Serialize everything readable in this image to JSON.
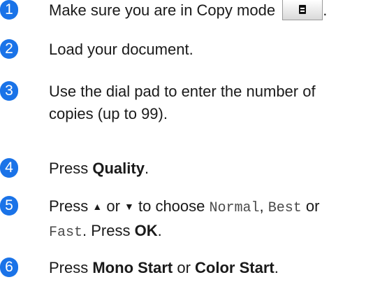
{
  "steps": [
    {
      "num": "1",
      "text": "Make sure you are in Copy mode",
      "after": "."
    },
    {
      "num": "2",
      "text": "Load your document."
    },
    {
      "num": "3",
      "line1": "Use the dial pad to enter the number of",
      "line2": "copies (up to 99)."
    },
    {
      "num": "4",
      "pre": "Press ",
      "bold": "Quality",
      "post": "."
    },
    {
      "num": "5",
      "l1_pre": "Press ",
      "up": "▲",
      "mid": " or ",
      "down": "▼",
      "l1_post": " to choose ",
      "opt1": "Normal",
      "sep": ", ",
      "opt2": "Best",
      "or": " or",
      "opt3": "Fast",
      "l2_mid": ". Press ",
      "ok": "OK",
      "end": "."
    },
    {
      "num": "6",
      "pre": "Press ",
      "bold1": "Mono Start",
      "mid": " or ",
      "bold2": "Color Start",
      "post": "."
    }
  ],
  "colors": {
    "accent": "#1a73e8"
  },
  "icons": {
    "copy_mode": "copy-mode-icon"
  }
}
